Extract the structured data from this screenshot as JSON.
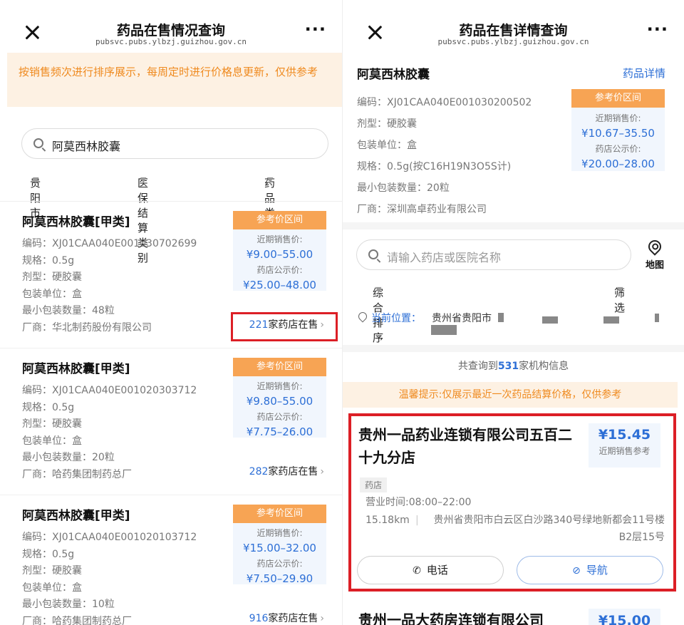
{
  "left": {
    "nav": {
      "title": "药品在售情况查询",
      "subtitle": "pubsvc.pubs.ylbzj.guizhou.gov.cn",
      "more": "···"
    },
    "notice": "按销售频次进行排序展示，每周定时进行价格息更新，仅供参考",
    "search": {
      "value": "阿莫西林胶囊"
    },
    "filters": [
      "贵阳市",
      "医保结算类别",
      "药品类别"
    ],
    "cards": [
      {
        "title": "阿莫西林胶囊[甲类]",
        "code": "编码：XJ01CAA040E001030702699",
        "spec": "规格：0.5g",
        "form": "剂型：硬胶囊",
        "unit": "包装单位：盒",
        "min_qty": "最小包装数量：48粒",
        "maker": "厂商：华北制药股份有限公司",
        "price_head": "参考价区间",
        "recent_label": "近期销售价:",
        "recent_price": "¥9.00–55.00",
        "public_label": "药店公示价:",
        "public_price": "¥25.00–48.00",
        "store_count": "221",
        "store_suffix": "家药店在售"
      },
      {
        "title": "阿莫西林胶囊[甲类]",
        "code": "编码：XJ01CAA040E001020303712",
        "spec": "规格：0.5g",
        "form": "剂型：硬胶囊",
        "unit": "包装单位：盒",
        "min_qty": "最小包装数量：20粒",
        "maker": "厂商：哈药集团制药总厂",
        "price_head": "参考价区间",
        "recent_label": "近期销售价:",
        "recent_price": "¥9.80–55.00",
        "public_label": "药店公示价:",
        "public_price": "¥7.75–26.00",
        "store_count": "282",
        "store_suffix": "家药店在售"
      },
      {
        "title": "阿莫西林胶囊[甲类]",
        "code": "编码：XJ01CAA040E001020103712",
        "spec": "规格：0.5g",
        "form": "剂型：硬胶囊",
        "unit": "包装单位：盒",
        "min_qty": "最小包装数量：10粒",
        "maker": "厂商：哈药集团制药总厂",
        "price_head": "参考价区间",
        "recent_label": "近期销售价:",
        "recent_price": "¥15.00–32.00",
        "public_label": "药店公示价:",
        "public_price": "¥7.50–29.90",
        "store_count": "916",
        "store_suffix": "家药店在售"
      }
    ]
  },
  "right": {
    "nav": {
      "title": "药品在售详情查询",
      "subtitle": "pubsvc.pubs.ylbzj.guizhou.gov.cn",
      "more": "···"
    },
    "drug": {
      "name": "阿莫西林胶囊",
      "detail_link": "药品详情",
      "code": "编码：XJ01CAA040E001030200502",
      "form": "剂型：硬胶囊",
      "unit": "包装单位：盒",
      "spec": "规格：0.5g(按C16H19N3O5S计)",
      "min_qty": "最小包装数量：20粒",
      "maker": "厂商：深圳高卓药业有限公司",
      "price_head": "参考价区间",
      "recent_label": "近期销售价:",
      "recent_price": "¥10.67–35.50",
      "public_label": "药店公示价:",
      "public_price": "¥20.00–28.00"
    },
    "search": {
      "placeholder": "请输入药店或医院名称"
    },
    "map_label": "地图",
    "sort": {
      "order": "综合排序",
      "filter": "筛选"
    },
    "location": {
      "label": "当前位置：",
      "value": "贵州省贵阳市"
    },
    "total": {
      "prefix": "共查询到",
      "count": "531",
      "suffix": "家机构信息"
    },
    "tip": "温馨提示:仅展示最近一次药品结算价格，仅供参考",
    "store": {
      "name": "贵州一品药业连锁有限公司五百二十九分店",
      "price": "¥15.45",
      "price_label": "近期销售参考",
      "tag": "药店",
      "hours": "营业时间:08:00–22:00",
      "distance": "15.18km",
      "address": "贵州省贵阳市白云区白沙路340号绿地新都会11号楼B2层15号",
      "call_label": "电话",
      "nav_label": "导航"
    },
    "next_store": {
      "name": "贵州一品大药房连锁有限公司",
      "price": "¥15.00"
    }
  }
}
